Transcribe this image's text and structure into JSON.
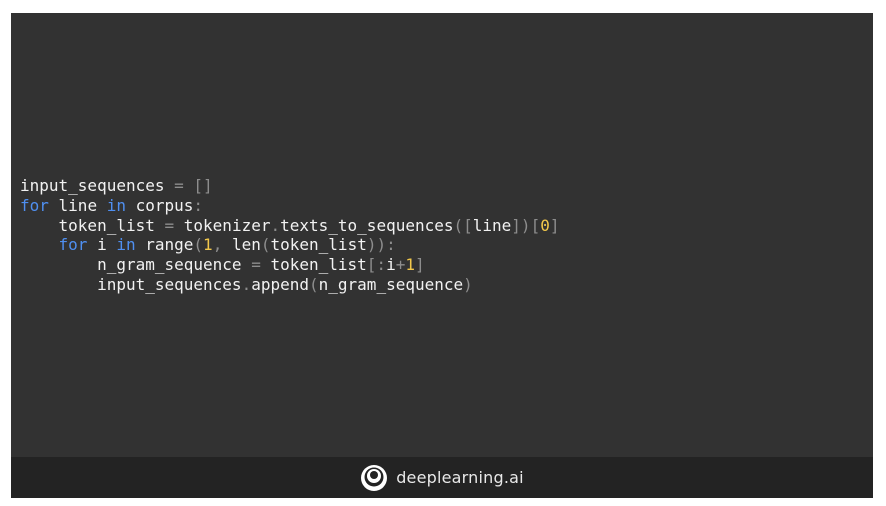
{
  "code": {
    "tokens": [
      [
        {
          "t": "input_sequences",
          "c": "id"
        },
        {
          "t": " ",
          "c": "sp"
        },
        {
          "t": "=",
          "c": "pn"
        },
        {
          "t": " ",
          "c": "sp"
        },
        {
          "t": "[]",
          "c": "pn"
        }
      ],
      [
        {
          "t": "for",
          "c": "kw"
        },
        {
          "t": " line ",
          "c": "id"
        },
        {
          "t": "in",
          "c": "kw"
        },
        {
          "t": " corpus",
          "c": "id"
        },
        {
          "t": ":",
          "c": "pn"
        }
      ],
      [
        {
          "t": "    token_list ",
          "c": "id"
        },
        {
          "t": "=",
          "c": "pn"
        },
        {
          "t": " tokenizer",
          "c": "id"
        },
        {
          "t": ".",
          "c": "pn"
        },
        {
          "t": "texts_to_sequences",
          "c": "id"
        },
        {
          "t": "([",
          "c": "pn"
        },
        {
          "t": "line",
          "c": "id"
        },
        {
          "t": "])[",
          "c": "pn"
        },
        {
          "t": "0",
          "c": "num"
        },
        {
          "t": "]",
          "c": "pn"
        }
      ],
      [
        {
          "t": "    ",
          "c": "sp"
        },
        {
          "t": "for",
          "c": "kw"
        },
        {
          "t": " i ",
          "c": "id"
        },
        {
          "t": "in",
          "c": "kw"
        },
        {
          "t": " range",
          "c": "id"
        },
        {
          "t": "(",
          "c": "pn"
        },
        {
          "t": "1",
          "c": "num"
        },
        {
          "t": ", ",
          "c": "pn"
        },
        {
          "t": "len",
          "c": "id"
        },
        {
          "t": "(",
          "c": "pn"
        },
        {
          "t": "token_list",
          "c": "id"
        },
        {
          "t": ")):",
          "c": "pn"
        }
      ],
      [
        {
          "t": "        n_gram_sequence ",
          "c": "id"
        },
        {
          "t": "=",
          "c": "pn"
        },
        {
          "t": " token_list",
          "c": "id"
        },
        {
          "t": "[:",
          "c": "pn"
        },
        {
          "t": "i",
          "c": "id"
        },
        {
          "t": "+",
          "c": "pn"
        },
        {
          "t": "1",
          "c": "num"
        },
        {
          "t": "]",
          "c": "pn"
        }
      ],
      [
        {
          "t": "        input_sequences",
          "c": "id"
        },
        {
          "t": ".",
          "c": "pn"
        },
        {
          "t": "append",
          "c": "id"
        },
        {
          "t": "(",
          "c": "pn"
        },
        {
          "t": "n_gram_sequence",
          "c": "id"
        },
        {
          "t": ")",
          "c": "pn"
        }
      ]
    ]
  },
  "footer": {
    "brand": "deeplearning.ai",
    "logo_icon": "deeplearning-ai-logo-icon"
  },
  "colors": {
    "slide_bg": "#323232",
    "footer_bg": "#232323",
    "keyword": "#4f8ff0",
    "number": "#f2c84b",
    "punctuation": "#8d8d8d",
    "text": "#f2f2f2"
  }
}
